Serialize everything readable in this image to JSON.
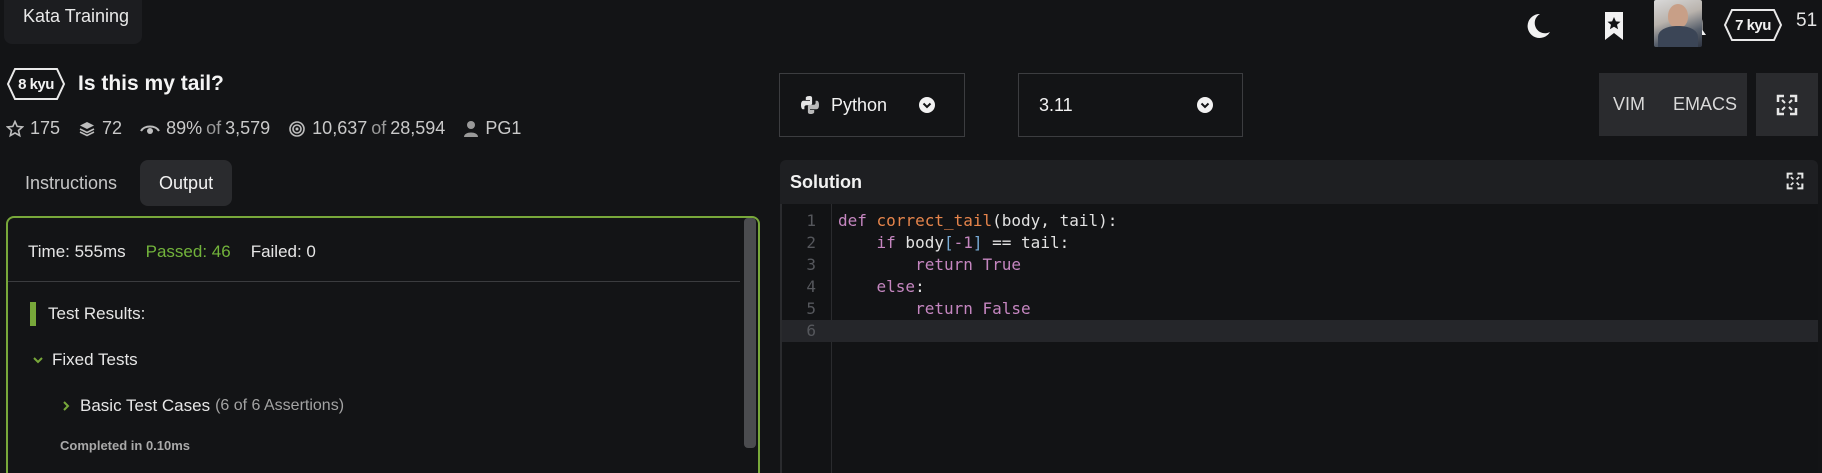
{
  "topbar": {
    "kata_training_label": "Kata Training",
    "theme_icon": "moon-icon",
    "bookmarks_icon": "bookmark-star-icon",
    "notifications_icon": "bell-icon",
    "user_rank": "7 kyu",
    "honor": "51"
  },
  "kata": {
    "rank": "8 kyu",
    "title": "Is this my tail?",
    "stars": "175",
    "collections": "72",
    "satisfaction": "89%",
    "satisfaction_votes": "3,579",
    "completions": "10,637",
    "attempts": "28,594",
    "author": "PG1",
    "of_word": "of"
  },
  "tabs": [
    {
      "label": "Instructions",
      "active": false
    },
    {
      "label": "Output",
      "active": true
    }
  ],
  "output": {
    "time": "Time: 555ms",
    "passed": "Passed: 46",
    "failed": "Failed: 0",
    "results_title": "Test Results:",
    "group_label": "Fixed Tests",
    "subgroup_label": "Basic Test Cases",
    "subgroup_meta": "(6 of 6 Assertions)",
    "completed": "Completed in 0.10ms"
  },
  "language": {
    "selected": "Python",
    "icon": "python-icon"
  },
  "version": {
    "selected": "3.11"
  },
  "keymaps": {
    "vim_label": "VIM",
    "emacs_label": "EMACS"
  },
  "solution": {
    "title": "Solution",
    "lines": [
      {
        "num": "1",
        "text": "def correct_tail(body, tail):"
      },
      {
        "num": "2",
        "text": "    if body[-1] == tail:"
      },
      {
        "num": "3",
        "text": "        return True"
      },
      {
        "num": "4",
        "text": "    else:"
      },
      {
        "num": "5",
        "text": "        return False"
      },
      {
        "num": "6",
        "text": ""
      }
    ],
    "active_line": 6
  },
  "colors": {
    "accent_green": "#78a83a",
    "passed_green": "#72b33b",
    "background": "#131416",
    "keyword": "#c586c0",
    "function": "#e5844b"
  }
}
